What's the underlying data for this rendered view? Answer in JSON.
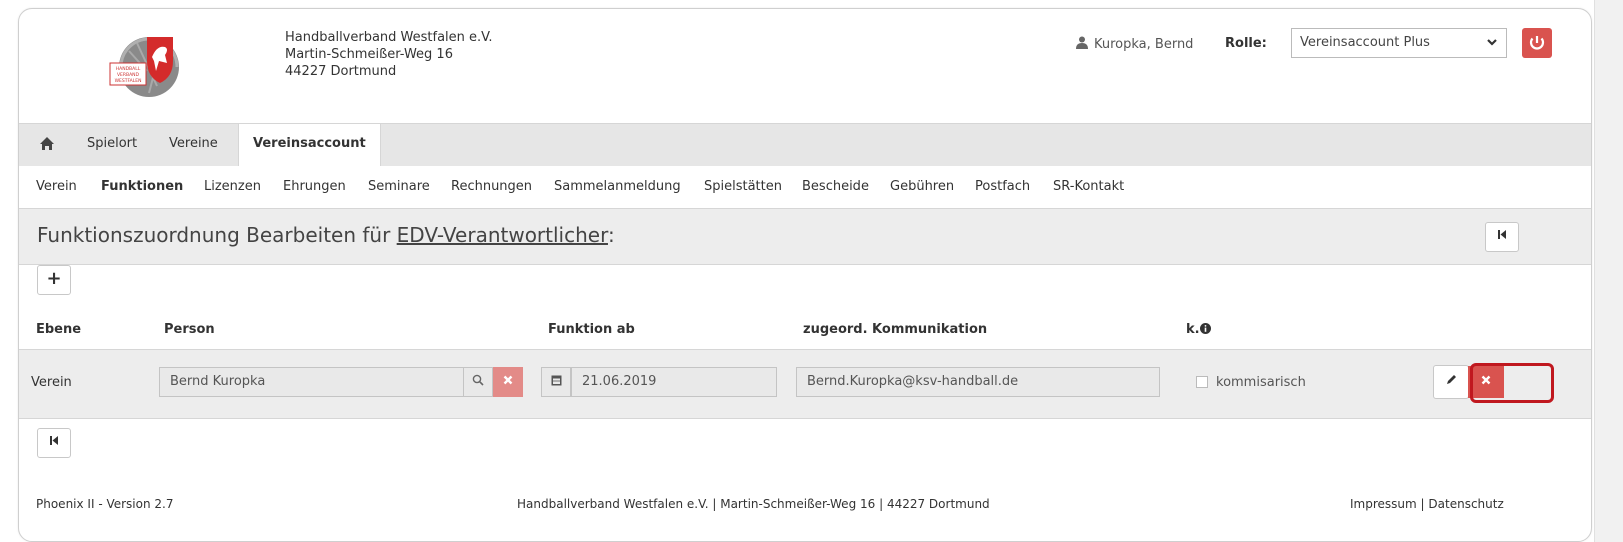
{
  "header": {
    "org_name": "Handballverband Westfalen e.V.",
    "street": "Martin-Schmeißer-Weg 16",
    "city": "44227 Dortmund",
    "user_name": "Kuropka, Bernd",
    "role_label": "Rolle:",
    "role_value": "Vereinsaccount Plus",
    "logo_text": [
      "HANDBALL",
      "VERBAND",
      "WESTFALEN"
    ]
  },
  "tabs": [
    "Spielort",
    "Vereine",
    "Vereinsaccount"
  ],
  "subnav": [
    "Verein",
    "Funktionen",
    "Lizenzen",
    "Ehrungen",
    "Seminare",
    "Rechnungen",
    "Sammelanmeldung",
    "Spielstätten",
    "Bescheide",
    "Gebühren",
    "Postfach",
    "SR-Kontakt"
  ],
  "title": {
    "prefix": "Funktionszuordnung Bearbeiten für ",
    "link": "EDV-Verantwortlicher",
    "suffix": ":"
  },
  "buttons": {
    "add": "+",
    "back": "K"
  },
  "table": {
    "headers": [
      "Ebene",
      "Person",
      "Funktion ab",
      "zugeord. Kommunikation",
      "k."
    ],
    "row": {
      "ebene": "Verein",
      "person": "Bernd Kuropka",
      "funktion_ab": "21.06.2019",
      "kommunikation": "Bernd.Kuropka@ksv-handball.de",
      "kommisarisch_label": "kommisarisch",
      "kommisarisch_checked": false
    }
  },
  "footer": {
    "version": "Phoenix II - Version 2.7",
    "address": "Handballverband Westfalen e.V. | Martin-Schmeißer-Weg 16 | 44227 Dortmund",
    "impressum": "Impressum",
    "separator": "|",
    "datenschutz": "Datenschutz"
  },
  "colors": {
    "danger": "#d9534f",
    "highlight": "#c0181f",
    "bar_bg": "#e6e6e6"
  }
}
